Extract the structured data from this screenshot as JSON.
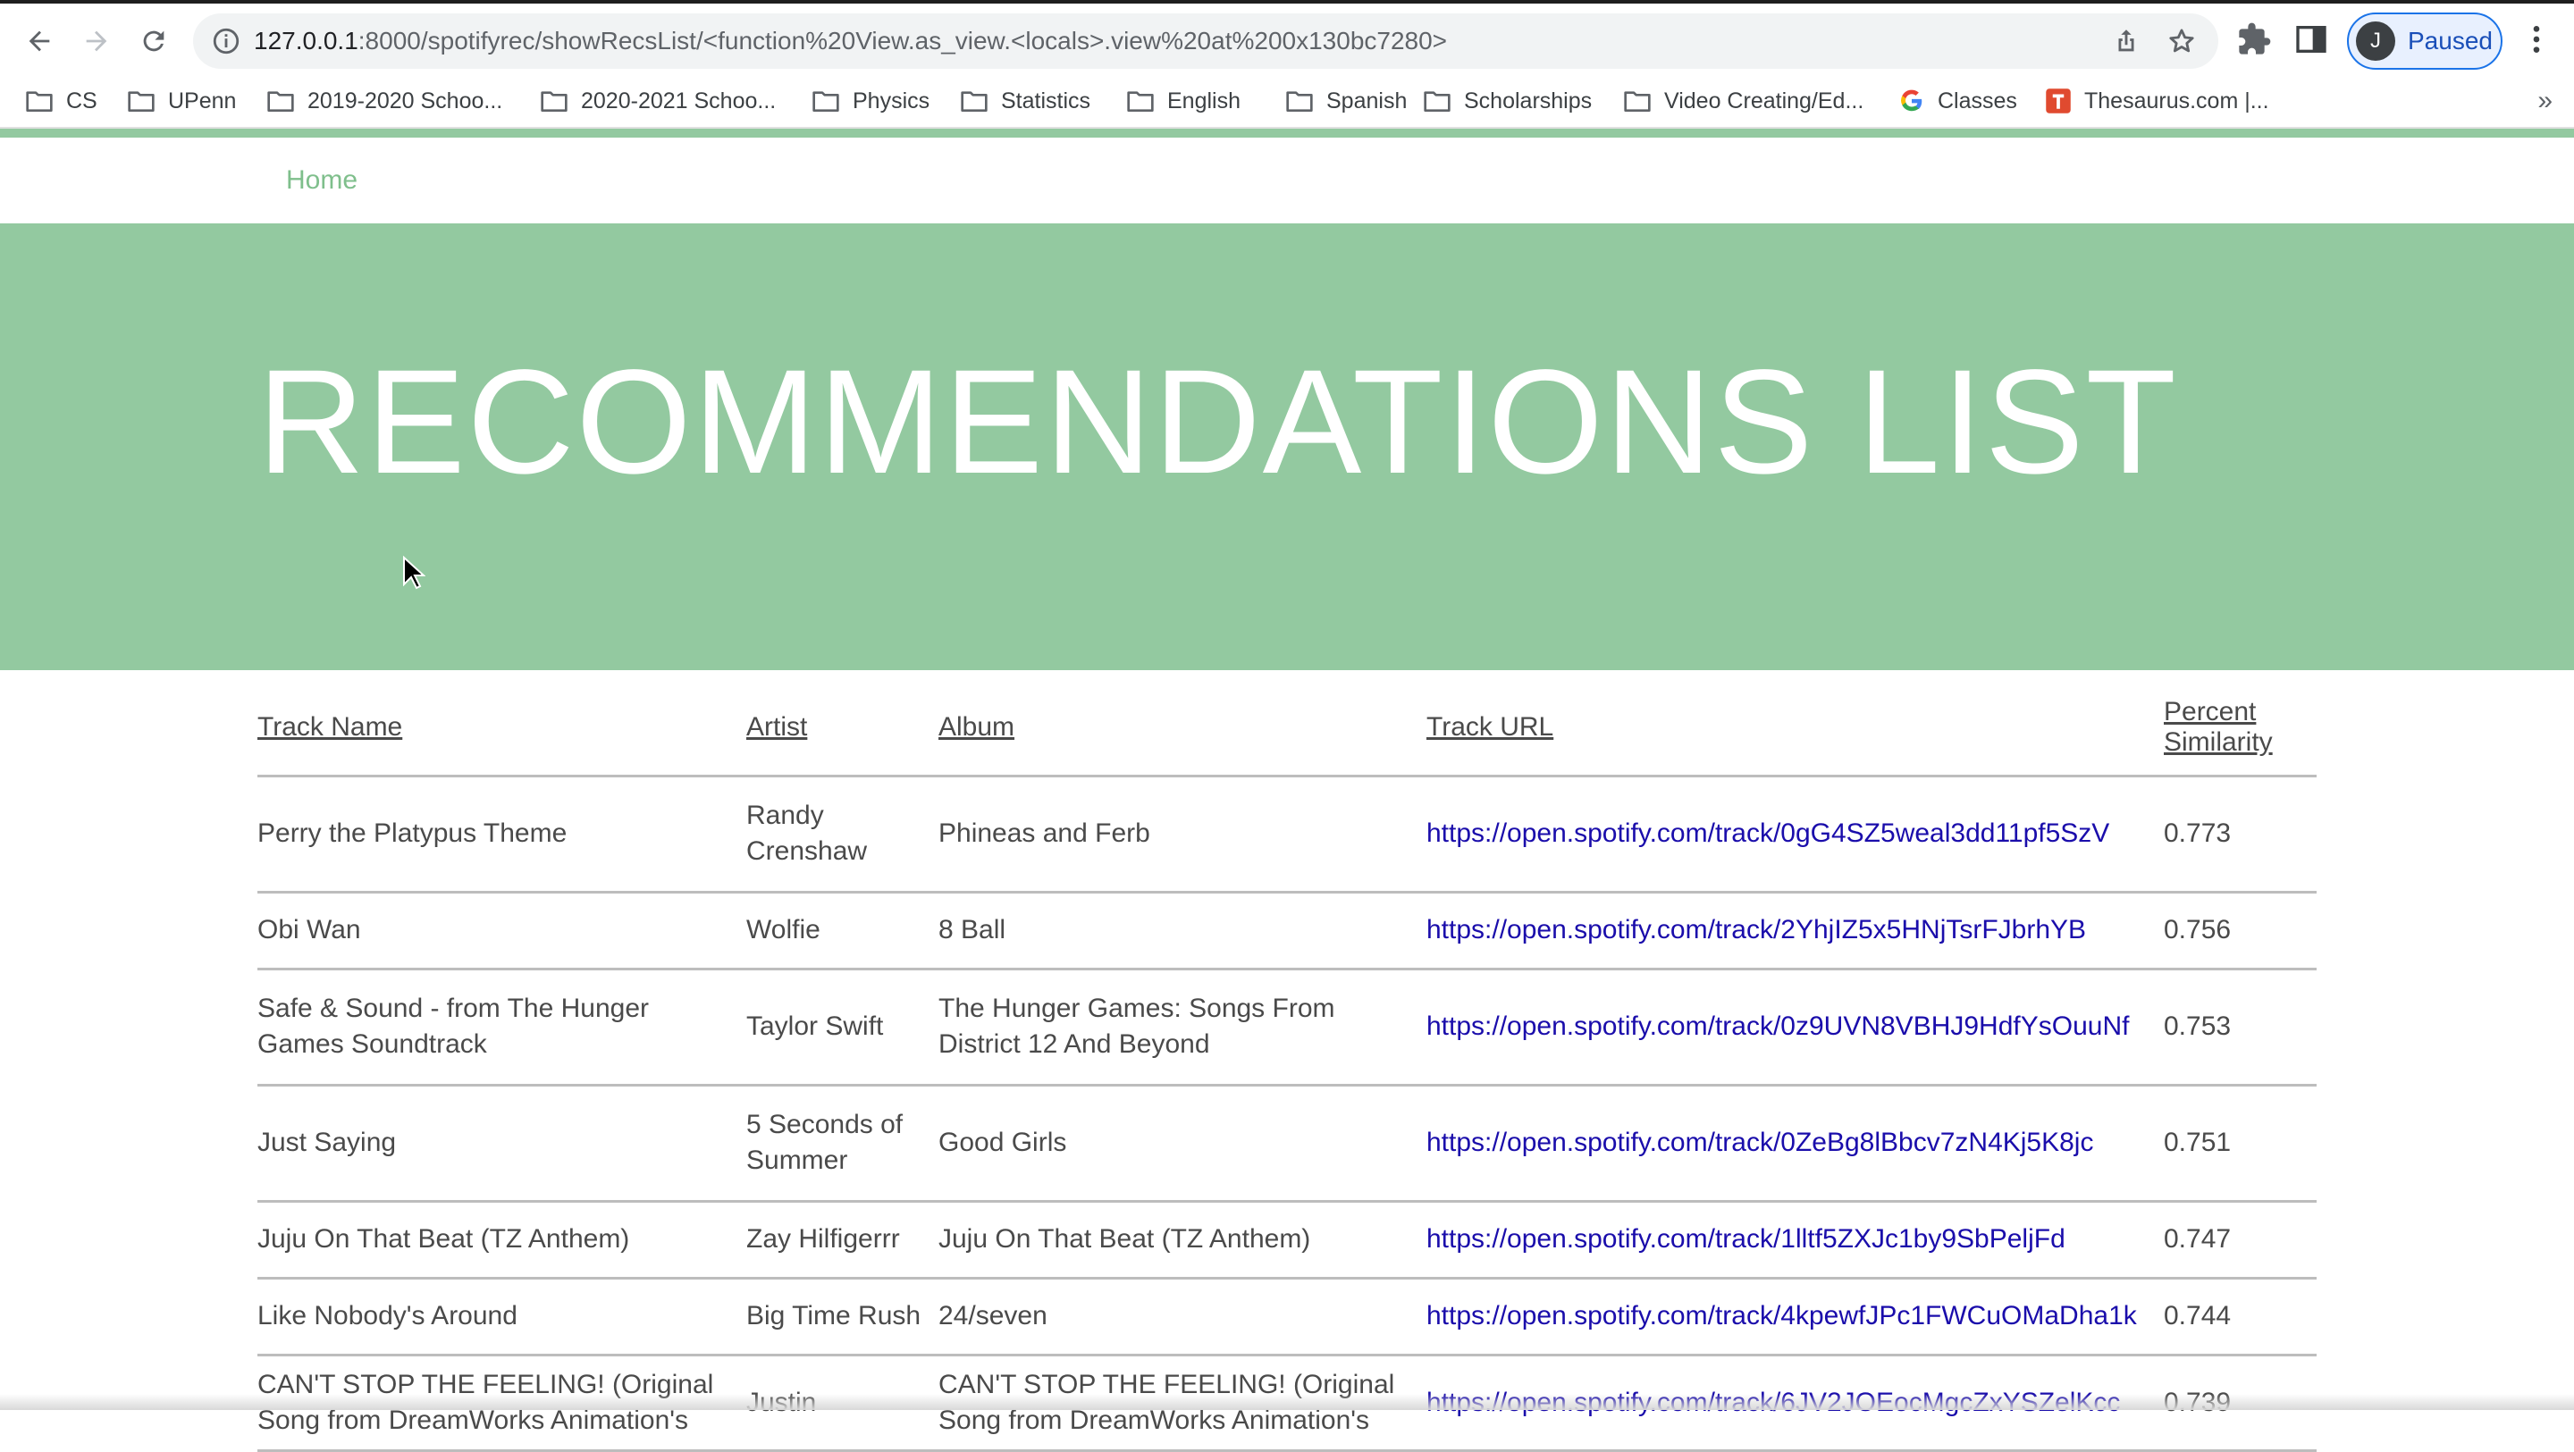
{
  "browser": {
    "url_host": "127.0.0.1",
    "url_rest": ":8000/spotifyrec/showRecsList/<function%20View.as_view.<locals>.view%20at%200x130bc7280>",
    "profile_initial": "J",
    "profile_status": "Paused",
    "bookmarks": [
      {
        "label": "CS",
        "icon": "folder-icon"
      },
      {
        "label": "UPenn",
        "icon": "folder-icon"
      },
      {
        "label": "2019-2020 Schoo...",
        "icon": "folder-icon"
      },
      {
        "label": "2020-2021 Schoo...",
        "icon": "folder-icon"
      },
      {
        "label": "Physics",
        "icon": "folder-icon"
      },
      {
        "label": "Statistics",
        "icon": "folder-icon"
      },
      {
        "label": "English",
        "icon": "folder-icon"
      },
      {
        "label": "Spanish",
        "icon": "folder-icon"
      },
      {
        "label": "Scholarships",
        "icon": "folder-icon"
      },
      {
        "label": "Video Creating/Ed...",
        "icon": "folder-icon"
      },
      {
        "label": "Classes",
        "icon": "google-icon"
      },
      {
        "label": "Thesaurus.com |...",
        "icon": "thesaurus-icon"
      }
    ],
    "bookmarks_more": "»"
  },
  "nav": {
    "home": "Home"
  },
  "hero": {
    "title": "RECOMMENDATIONS LIST"
  },
  "table": {
    "headers": [
      "Track Name",
      "Artist",
      "Album",
      "Track URL",
      "Percent Similarity"
    ],
    "rows": [
      {
        "track": "Perry the Platypus Theme",
        "artist": "Randy Crenshaw",
        "album": "Phineas and Ferb",
        "url": "https://open.spotify.com/track/0gG4SZ5weal3dd11pf5SzV",
        "similarity": "0.773"
      },
      {
        "track": "Obi Wan",
        "artist": "Wolfie",
        "album": "8 Ball",
        "url": "https://open.spotify.com/track/2YhjIZ5x5HNjTsrFJbrhYB",
        "similarity": "0.756"
      },
      {
        "track": "Safe & Sound - from The Hunger Games Soundtrack",
        "artist": "Taylor Swift",
        "album": "The Hunger Games: Songs From District 12 And Beyond",
        "url": "https://open.spotify.com/track/0z9UVN8VBHJ9HdfYsOuuNf",
        "similarity": "0.753"
      },
      {
        "track": "Just Saying",
        "artist": "5 Seconds of Summer",
        "album": "Good Girls",
        "url": "https://open.spotify.com/track/0ZeBg8lBbcv7zN4Kj5K8jc",
        "similarity": "0.751"
      },
      {
        "track": "Juju On That Beat (TZ Anthem)",
        "artist": "Zay Hilfigerrr",
        "album": "Juju On That Beat (TZ Anthem)",
        "url": "https://open.spotify.com/track/1lltf5ZXJc1by9SbPeljFd",
        "similarity": "0.747"
      },
      {
        "track": "Like Nobody's Around",
        "artist": "Big Time Rush",
        "album": "24/seven",
        "url": "https://open.spotify.com/track/4kpewfJPc1FWCuOMaDha1k",
        "similarity": "0.744"
      },
      {
        "track": "CAN'T STOP THE FEELING! (Original Song from DreamWorks Animation's",
        "artist": "Justin",
        "album": "CAN'T STOP THE FEELING! (Original Song from DreamWorks Animation's",
        "url": "https://open.spotify.com/track/6JV2JOEocMgcZxYSZelKcc",
        "similarity": "0.739"
      }
    ]
  },
  "colors": {
    "accent": "#93c9a0",
    "link": "#1a0dab"
  }
}
